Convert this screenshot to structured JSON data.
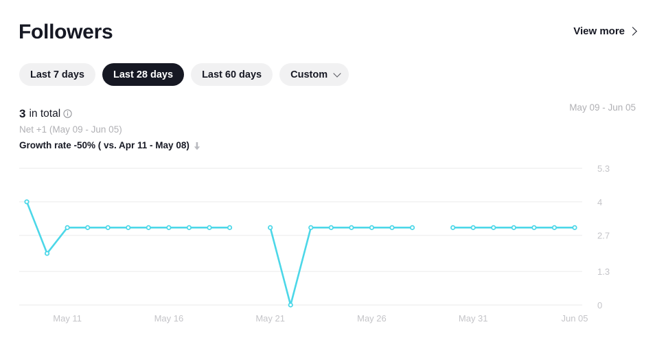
{
  "header": {
    "title": "Followers",
    "view_more_label": "View more",
    "chevron_icon": "chevron-right-icon"
  },
  "range_tabs": [
    {
      "label": "Last 7 days",
      "active": false
    },
    {
      "label": "Last 28 days",
      "active": true
    },
    {
      "label": "Last 60 days",
      "active": false
    },
    {
      "label": "Custom",
      "active": false,
      "has_dropdown": true
    }
  ],
  "summary": {
    "total_value": "3",
    "total_suffix": "in total",
    "info_icon": "info-icon",
    "net_text": "Net +1 (May 09 - Jun 05)",
    "growth_text": "Growth rate -50% ( vs. Apr 11 - May 08)",
    "growth_direction_icon": "arrow-down-icon",
    "date_range": "May 09 - Jun 05"
  },
  "colors": {
    "line": "#4cd7e8",
    "accent_dark": "#161823",
    "pill_bg": "#f1f1f2",
    "muted_text": "#b0b0b4",
    "grid": "#f0f0f1"
  },
  "chart_data": {
    "type": "line",
    "title": "Followers",
    "xlabel": "",
    "ylabel": "",
    "ylim": [
      0,
      5.3
    ],
    "yticks": [
      0,
      1.3,
      2.7,
      4,
      5.3
    ],
    "ytick_labels": [
      "0",
      "1.3",
      "2.7",
      "4",
      "5.3"
    ],
    "xtick_labels": [
      "May 11",
      "May 16",
      "May 21",
      "May 26",
      "May 31",
      "Jun 05"
    ],
    "xtick_indices": [
      2,
      7,
      12,
      17,
      22,
      27
    ],
    "grid": true,
    "legend": "none",
    "x": [
      "May 09",
      "May 10",
      "May 11",
      "May 12",
      "May 13",
      "May 14",
      "May 15",
      "May 16",
      "May 17",
      "May 18",
      "May 19",
      "May 20",
      "May 21",
      "May 22",
      "May 23",
      "May 24",
      "May 25",
      "May 26",
      "May 27",
      "May 28",
      "May 29",
      "May 30",
      "May 31",
      "Jun 01",
      "Jun 02",
      "Jun 03",
      "Jun 04",
      "Jun 05"
    ],
    "series": [
      {
        "name": "Followers",
        "values": [
          4,
          2,
          3,
          3,
          3,
          3,
          3,
          3,
          3,
          3,
          3,
          null,
          3,
          0,
          3,
          3,
          3,
          3,
          3,
          3,
          null,
          3,
          3,
          3,
          3,
          3,
          3,
          3
        ]
      }
    ]
  }
}
